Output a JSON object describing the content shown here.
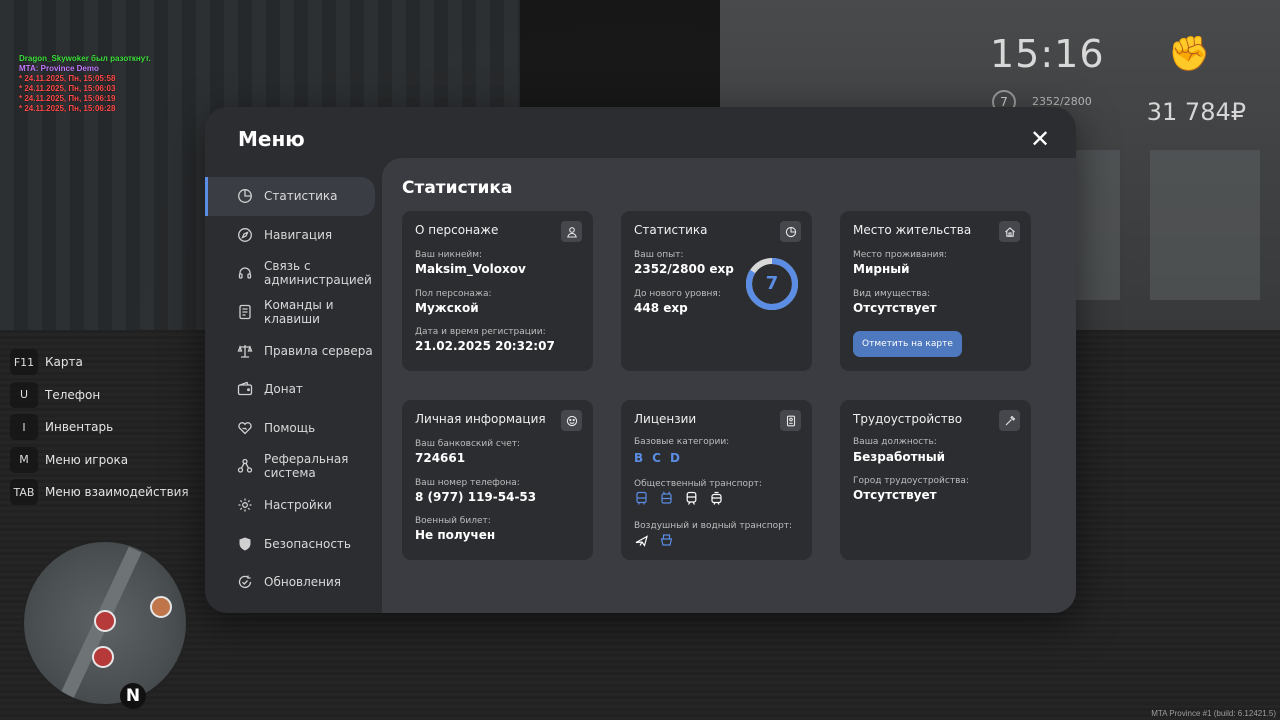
{
  "chat": [
    {
      "text": "Dragon_Skywoker был разоткнут.",
      "color": "#3fe13f"
    },
    {
      "text": "MTA: Province Demo",
      "color": "#c37cff"
    },
    {
      "text": "* 24.11.2025, Пн, 15:05:58",
      "color": "#ff4a4a"
    },
    {
      "text": "* 24.11.2025, Пн, 15:06:03",
      "color": "#ff4a4a"
    },
    {
      "text": "* 24.11.2025, Пн, 15:06:19",
      "color": "#ff4a4a"
    },
    {
      "text": "* 24.11.2025, Пн, 15:06:28",
      "color": "#ff4a4a"
    }
  ],
  "hud": {
    "time": "15:16",
    "level": "7",
    "xp": "2352/2800",
    "money": "31 784₽"
  },
  "keys": [
    {
      "key": "F11",
      "label": "Карта"
    },
    {
      "key": "U",
      "label": "Телефон"
    },
    {
      "key": "I",
      "label": "Инвентарь"
    },
    {
      "key": "M",
      "label": "Меню игрока"
    },
    {
      "key": "TAB",
      "label": "Меню взаимодействия"
    }
  ],
  "minimap": {
    "north": "N"
  },
  "build": "MTA Province #1 (build: 6.12421.5)",
  "menu": {
    "title": "Меню",
    "close": "✕",
    "sidebar": [
      {
        "label": "Статистика",
        "icon": "pie-chart-icon",
        "active": true
      },
      {
        "label": "Навигация",
        "icon": "compass-icon",
        "active": false
      },
      {
        "label": "Связь с администрацией",
        "icon": "headset-icon",
        "active": false
      },
      {
        "label": "Команды и клавиши",
        "icon": "document-icon",
        "active": false
      },
      {
        "label": "Правила сервера",
        "icon": "scales-icon",
        "active": false
      },
      {
        "label": "Донат",
        "icon": "wallet-icon",
        "active": false
      },
      {
        "label": "Помощь",
        "icon": "heart-hand-icon",
        "active": false
      },
      {
        "label": "Реферальная система",
        "icon": "network-icon",
        "active": false
      },
      {
        "label": "Настройки",
        "icon": "gear-icon",
        "active": false
      },
      {
        "label": "Безопасность",
        "icon": "shield-icon",
        "active": false
      },
      {
        "label": "Обновления",
        "icon": "refresh-check-icon",
        "active": false
      }
    ]
  },
  "content": {
    "title": "Статистика",
    "character": {
      "title": "О персонаже",
      "icon": "user-icon",
      "nickname_label": "Ваш никнейм:",
      "nickname": "Maksim_Voloxov",
      "gender_label": "Пол персонажа:",
      "gender": "Мужской",
      "reg_label": "Дата и время регистрации:",
      "reg": "21.02.2025 20:32:07"
    },
    "stats": {
      "title": "Статистика",
      "icon": "pie-chart-icon",
      "exp_label": "Ваш опыт:",
      "exp": "2352/2800 exp",
      "next_label": "До нового уровня:",
      "next": "448 exp",
      "level": "7",
      "progress": 0.84,
      "ring_color": "#5a8de3",
      "ring_track": "#d8d8d8"
    },
    "residence": {
      "title": "Место жительства",
      "icon": "house-icon",
      "place_label": "Место проживания:",
      "place": "Мирный",
      "property_label": "Вид имущества:",
      "property": "Отсутствует",
      "button": "Отметить на карте"
    },
    "personal": {
      "title": "Личная информация",
      "icon": "id-face-icon",
      "bank_label": "Ваш банковский счет:",
      "bank": "724661",
      "phone_label": "Ваш номер телефона:",
      "phone": "8 (977) 119-54-53",
      "military_label": "Военный билет:",
      "military": "Не получен"
    },
    "licenses": {
      "title": "Лицензии",
      "icon": "badge-icon",
      "basic_label": "Базовые категории:",
      "categories": [
        "B",
        "C",
        "D"
      ],
      "public_label": "Общественный транспорт:",
      "public_icons": [
        "bus-icon",
        "trolleybus-icon",
        "train-icon",
        "tram-icon"
      ],
      "air_label": "Воздушный и водный транспорт:",
      "air_icons": [
        "plane-icon",
        "boat-icon"
      ]
    },
    "job": {
      "title": "Трудоустройство",
      "icon": "tools-icon",
      "position_label": "Ваша должность:",
      "position": "Безработный",
      "city_label": "Город трудоустройства:",
      "city": "Отсутствует"
    }
  }
}
